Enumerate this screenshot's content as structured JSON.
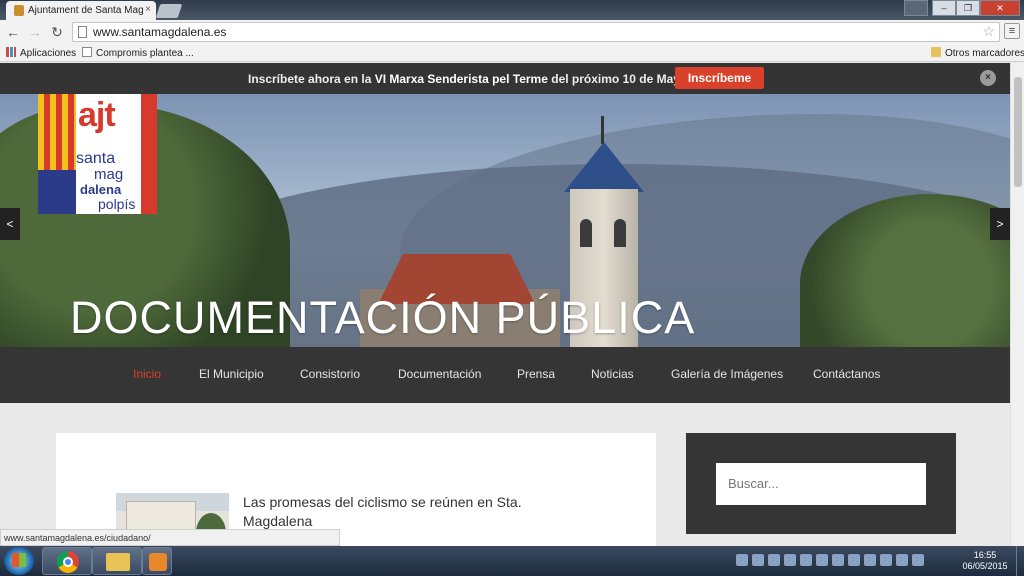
{
  "browser": {
    "tab_title": "Ajuntament de Santa Mag",
    "tab_close": "×",
    "url": "www.santamagdalena.es",
    "bookmarks": {
      "apps": "Aplicaciones",
      "item1": "Compromis plantea ...",
      "other": "Otros marcadores"
    },
    "status_url": "www.santamagdalena.es/ciudadano/",
    "window_controls": {
      "minimize": "–",
      "maximize": "❐",
      "close": "✕"
    }
  },
  "announcement": {
    "prefix": "Inscríbete ahora en la ",
    "event": "VI Marxa Senderista pel Terme",
    "suffix": " del próximo 10 de Mayo",
    "button": "Inscríbeme",
    "close": "×"
  },
  "logo": {
    "ajt": "ajt",
    "line1": "santa",
    "line2": "mag",
    "line3": "dalena",
    "line4": "polpís"
  },
  "hero": {
    "title": "DOCUMENTACIÓN PÚBLICA",
    "prev": "<",
    "next": ">"
  },
  "nav": {
    "items": [
      {
        "label": "Inicio",
        "active": true
      },
      {
        "label": "El Municipio"
      },
      {
        "label": "Consistorio"
      },
      {
        "label": "Documentación"
      },
      {
        "label": "Prensa"
      },
      {
        "label": "Noticias"
      },
      {
        "label": "Galería de Imágenes"
      },
      {
        "label": "Contáctanos"
      }
    ]
  },
  "post": {
    "title": "Las promesas del ciclismo se reúnen en Sta. Magdalena"
  },
  "sidebar": {
    "search_placeholder": "Buscar..."
  },
  "taskbar": {
    "time": "16:55",
    "date": "06/05/2015"
  },
  "colors": {
    "accent": "#d9412b",
    "dark_bar": "#353535"
  }
}
